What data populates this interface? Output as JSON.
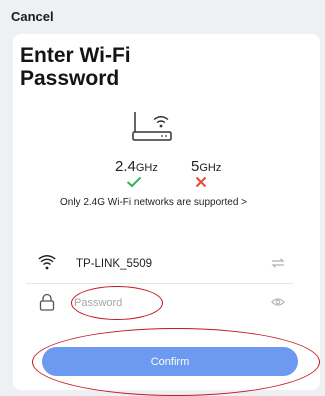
{
  "header": {
    "cancel_label": "Cancel"
  },
  "title_lines": [
    "Enter Wi-Fi",
    "Password"
  ],
  "router_icon": "router-with-wifi-icon",
  "bands": {
    "band_24": {
      "value": "2.4",
      "unit": "GHz",
      "status": "supported",
      "icon": "check-icon",
      "color": "#2fb35d"
    },
    "band_5": {
      "value": "5",
      "unit": "GHz",
      "status": "unsupported",
      "icon": "cross-icon",
      "color": "#e84a3c"
    }
  },
  "notice": "Only 2.4G Wi-Fi networks are supported >",
  "network": {
    "ssid": "TP-LINK_5509",
    "icon": "wifi-icon",
    "action_icon": "switch-network-icon"
  },
  "password": {
    "placeholder": "Password",
    "value": "",
    "icon": "lock-icon",
    "action_icon": "eye-icon"
  },
  "confirm_label": "Confirm",
  "colors": {
    "accent": "#6b9af0",
    "annotation": "#c7151b",
    "background": "#eef0f3"
  }
}
